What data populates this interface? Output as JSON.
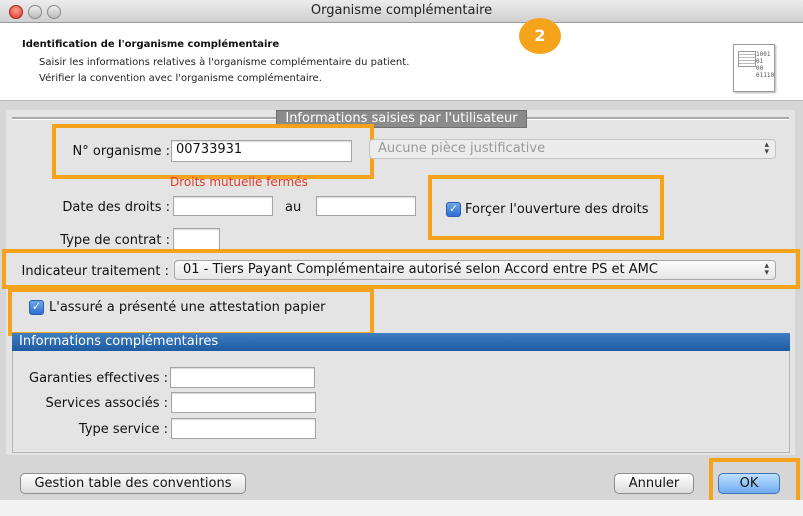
{
  "window": {
    "title": "Organisme complémentaire"
  },
  "header": {
    "title": "Identification de l'organisme complémentaire",
    "line1": "Saisir les informations relatives à l'organisme complémentaire du patient.",
    "line2": "Vérifier la convention avec l'organisme complémentaire.",
    "step_badge": "2",
    "doc_icon_text": "1001\n01\n00\n01110"
  },
  "section_user": {
    "title": "Informations saisies par l'utilisateur"
  },
  "form": {
    "organisme_label": "N° organisme :",
    "organisme_value": "00733931",
    "piece_select": "Aucune pièce justificative",
    "droits_warning": "Droits mutuelle fermés",
    "date_label": "Date des droits :",
    "au_label": "au",
    "date_from": "",
    "date_to": "",
    "forcer_label": "Forçer l'ouverture des droits",
    "forcer_checked": true,
    "type_contrat_label": "Type de contrat :",
    "type_contrat_value": "",
    "indicateur_label": "Indicateur traitement :",
    "indicateur_value": "01 - Tiers Payant Complémentaire autorisé selon Accord entre PS et AMC",
    "attestation_label": "L'assuré a présenté une attestation papier",
    "attestation_checked": true
  },
  "info_comp": {
    "title": "Informations complémentaires",
    "garanties_label": "Garanties effectives :",
    "services_label": "Services associés :",
    "type_service_label": "Type service :",
    "garanties_value": "",
    "services_value": "",
    "type_service_value": ""
  },
  "buttons": {
    "gestion": "Gestion table des conventions",
    "annuler": "Annuler",
    "ok": "OK"
  },
  "colors": {
    "highlight": "#f4a31a",
    "accent": "#1e5a9f",
    "warning": "#e03b2a"
  }
}
